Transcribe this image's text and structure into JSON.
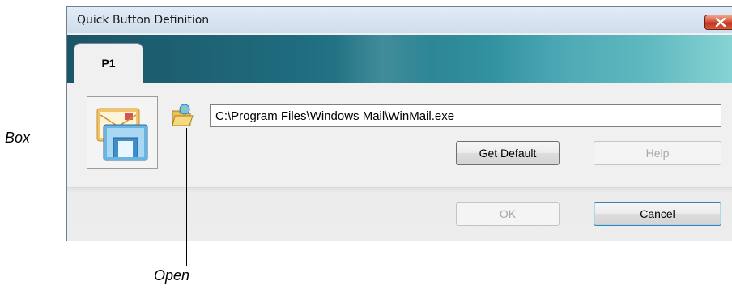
{
  "window": {
    "title": "Quick Button Definition",
    "close_icon": "close-x-icon"
  },
  "tabs": [
    {
      "label": "P1",
      "selected": true
    }
  ],
  "program": {
    "icon": "windows-mail-icon",
    "open_icon": "open-folder-icon",
    "path_value": "C:\\Program Files\\Windows Mail\\WinMail.exe"
  },
  "buttons": {
    "get_default": "Get Default",
    "help": "Help",
    "ok": "OK",
    "cancel": "Cancel"
  },
  "callouts": {
    "box": "Box",
    "open": "Open"
  },
  "colors": {
    "tab_strip_start": "#1b5567",
    "tab_strip_end": "#86d3d3",
    "close_button": "#c0341b"
  }
}
